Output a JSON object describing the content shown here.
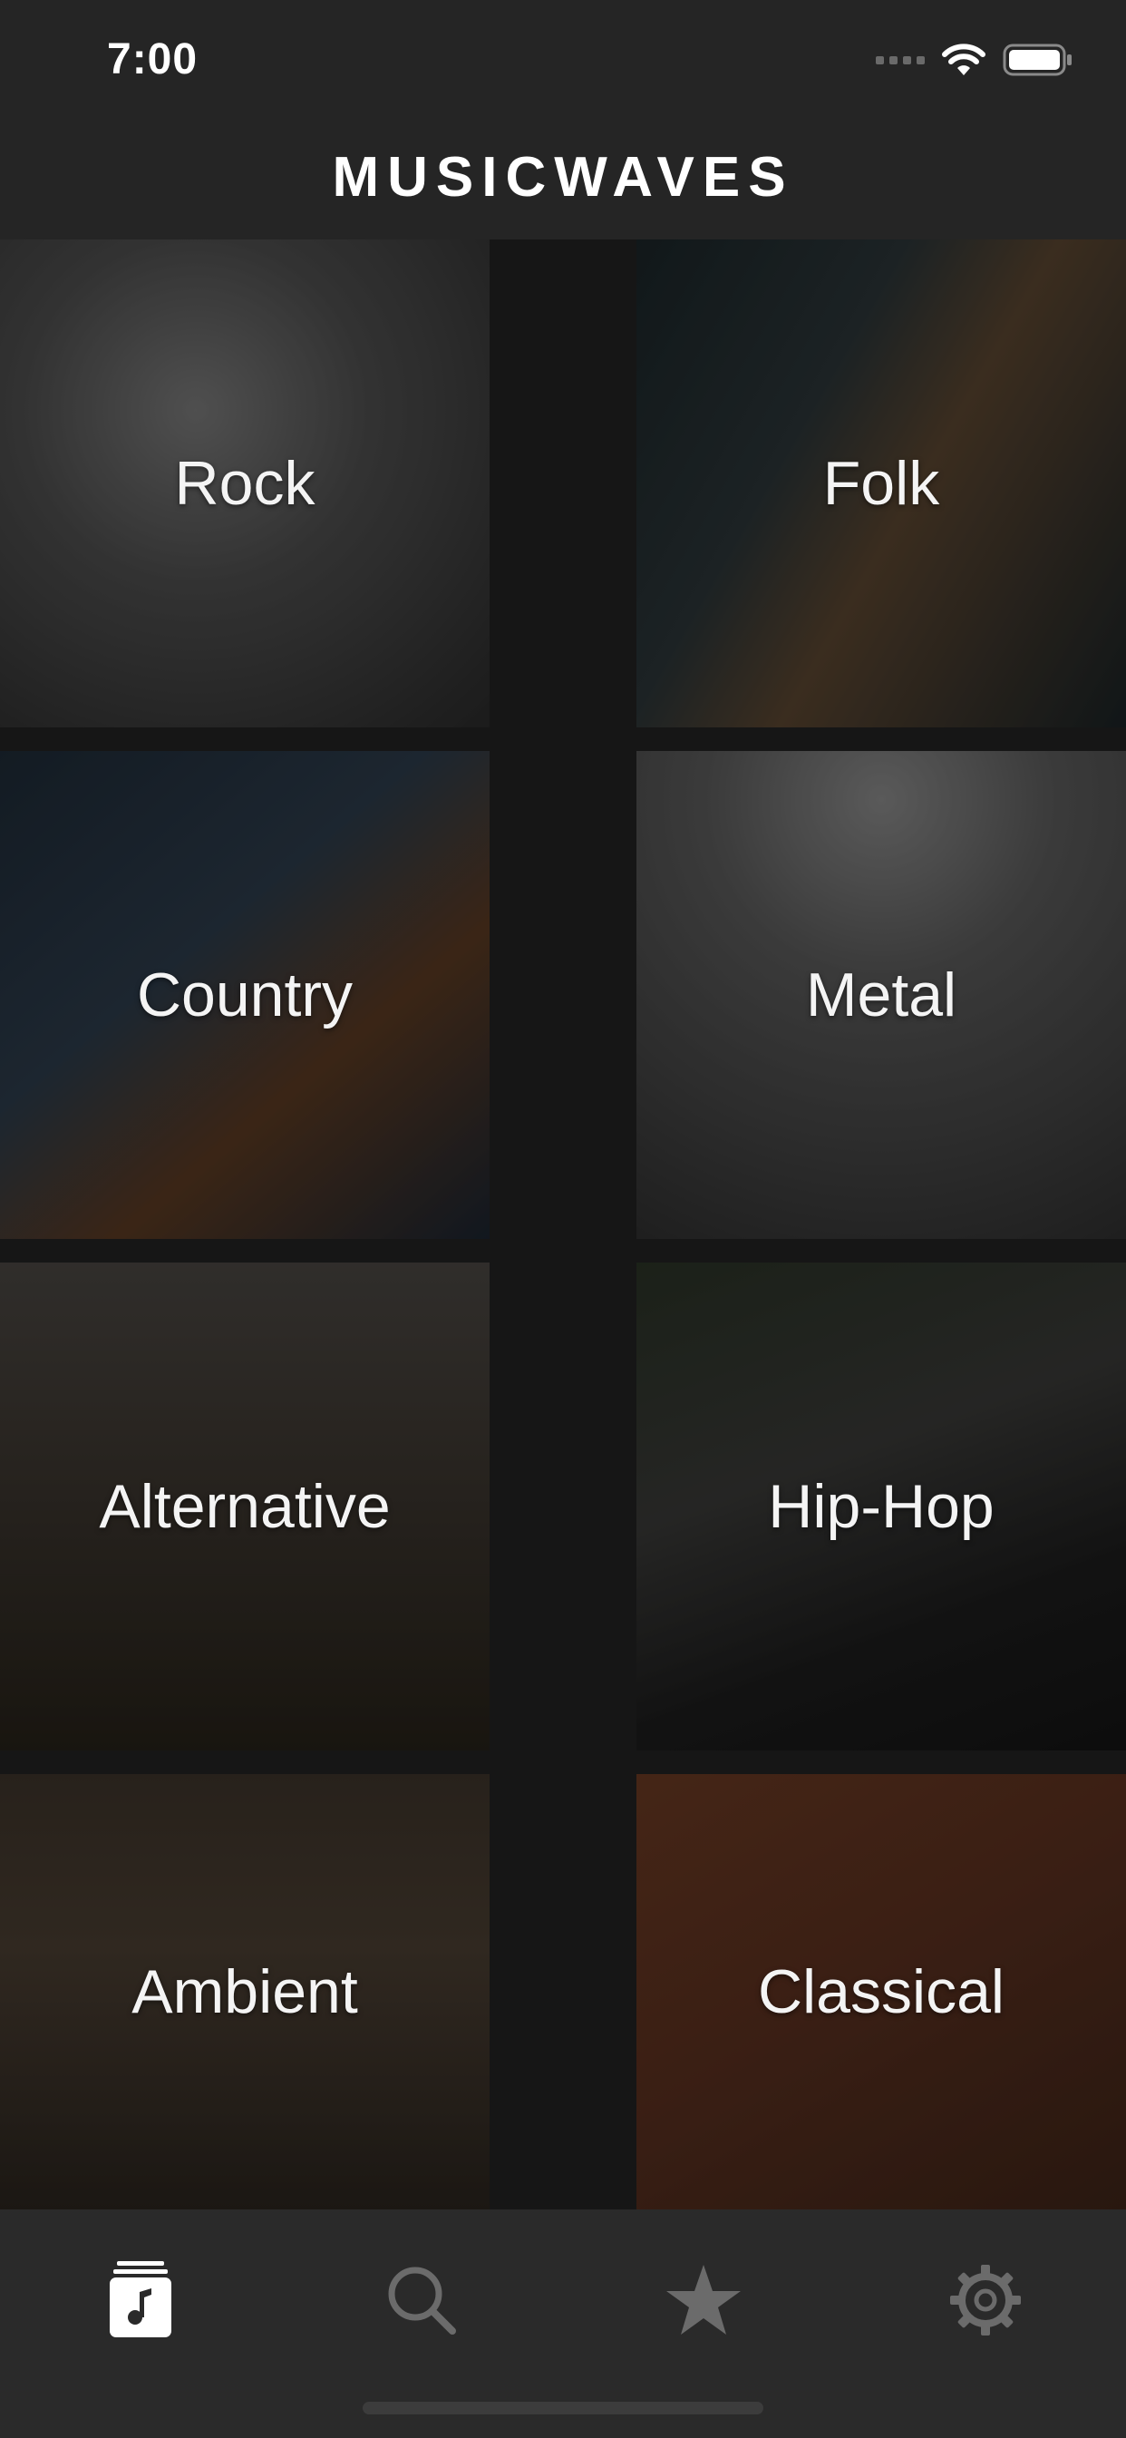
{
  "status_bar": {
    "time": "7:00"
  },
  "header": {
    "title": "MUSICWAVES"
  },
  "genres": [
    {
      "label": "Rock"
    },
    {
      "label": "Folk"
    },
    {
      "label": "Country"
    },
    {
      "label": "Metal"
    },
    {
      "label": "Alternative"
    },
    {
      "label": "Hip-Hop"
    },
    {
      "label": "Ambient"
    },
    {
      "label": "Classical"
    }
  ],
  "tab_bar": {
    "items": [
      {
        "icon": "music-library-icon",
        "active": true
      },
      {
        "icon": "search-icon",
        "active": false
      },
      {
        "icon": "star-icon",
        "active": false
      },
      {
        "icon": "gear-icon",
        "active": false
      }
    ]
  },
  "colors": {
    "background": "#161616",
    "header": "#252525",
    "tab_bar": "#2a2a2a",
    "tab_active": "#ffffff",
    "tab_inactive": "#6b6b6b"
  }
}
